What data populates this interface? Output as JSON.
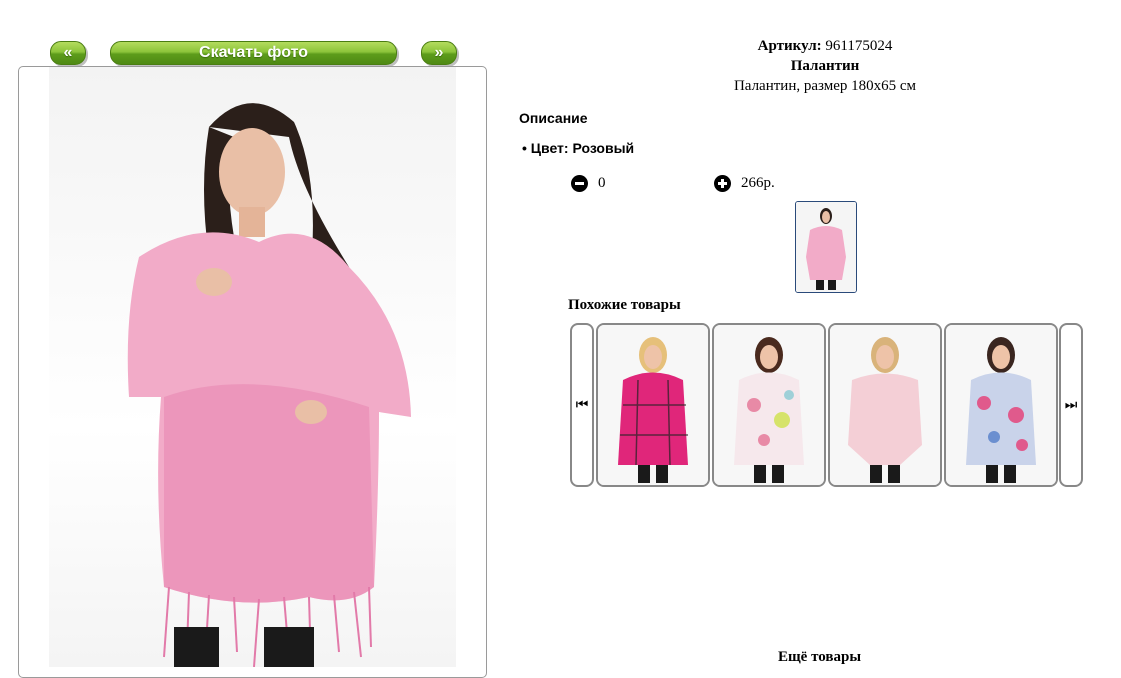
{
  "nav": {
    "prev_label": "«",
    "download_label": "Скачать фото",
    "next_label": "»"
  },
  "product": {
    "sku_label": "Артикул:",
    "sku_value": "961175024",
    "name": "Палантин",
    "subtitle": "Палантин, размер 180х65 см",
    "description_title": "Описание",
    "color_label": "Цвет:",
    "color_value": "Розовый",
    "quantity": "0",
    "price": "266р.",
    "photo_color": "#f3a9c6"
  },
  "similar": {
    "title": "Похожие товары",
    "items": [
      {
        "name": "pink-checked-scarf",
        "color": "#e0267a"
      },
      {
        "name": "floral-white-scarf",
        "color": "#f2d3dc"
      },
      {
        "name": "light-pink-scarf",
        "color": "#f4cfd6"
      },
      {
        "name": "floral-blue-scarf",
        "color": "#9fb3d9"
      }
    ]
  },
  "other": {
    "title": "Ещё товары"
  }
}
